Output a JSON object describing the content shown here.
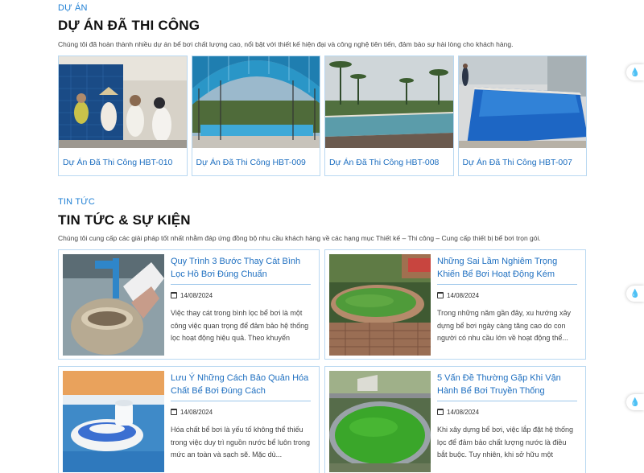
{
  "projects_section": {
    "eyebrow": "DỰ ÁN",
    "title": "DỰ ÁN ĐÃ THI CÔNG",
    "description": "Chúng tôi đã hoàn thành nhiều dự án bể bơi chất lượng cao, nổi bật với thiết kế hiện đại và công nghệ tiên tiến, đảm bảo sự hài lòng cho khách hàng.",
    "items": [
      {
        "caption": "Dự Án Đã Thi Công HBT-010"
      },
      {
        "caption": "Dự Án Đã Thi Công HBT-009"
      },
      {
        "caption": "Dự Án Đã Thi Công HBT-008"
      },
      {
        "caption": "Dự Án Đã Thi Công HBT-007"
      }
    ]
  },
  "news_section": {
    "eyebrow": "TIN TỨC",
    "title": "TIN TỨC & SỰ KIỆN",
    "description": "Chúng tôi cung cấp các giải pháp tốt nhất nhằm đáp ứng đồng bộ nhu cầu khách hàng về các hạng mục Thiết kế – Thi công – Cung cấp thiết bị bể bơi trọn gói.",
    "items": [
      {
        "title": "Quy Trình 3 Bước Thay Cát Bình Lọc Hồ Bơi Đúng Chuẩn",
        "date": "14/08/2024",
        "excerpt": "Việc thay cát trong bình lọc bể bơi là một công việc quan trọng để đảm bảo hệ thống lọc hoạt động hiệu quả. Theo khuyến cáo,..."
      },
      {
        "title": "Những Sai Lầm Nghiêm Trọng Khiến Bể Bơi Hoạt Động Kém Hiệ...",
        "date": "14/08/2024",
        "excerpt": "Trong những năm gần đây, xu hướng xây dựng bể bơi ngày càng tăng cao do con người có nhu cầu lớn về hoạt động thể..."
      },
      {
        "title": "Lưu Ý Những Cách Bảo Quản Hóa Chất Bể Bơi Đúng Cách",
        "date": "14/08/2024",
        "excerpt": "Hóa chất bể bơi là yếu tố không thể thiếu trong việc duy trì nguồn nước bể luôn trong mức an toàn và sạch sẽ. Mặc dù..."
      },
      {
        "title": "5 Vấn Đề Thường Gặp Khi Vận Hành Bể Bơi Truyền Thống",
        "date": "14/08/2024",
        "excerpt": "Khi xây dựng bể bơi, việc lắp đặt hệ thống lọc để đảm bảo chất lượng nước là điều bắt buộc. Tuy nhiên, khi sở hữu một phòn..."
      }
    ]
  },
  "icons": {
    "calendar": "calendar-icon",
    "float": "water-drop-icon"
  },
  "colors": {
    "accent": "#1e7fd4",
    "link": "#1e6fc0",
    "border": "#b9d8f1"
  }
}
